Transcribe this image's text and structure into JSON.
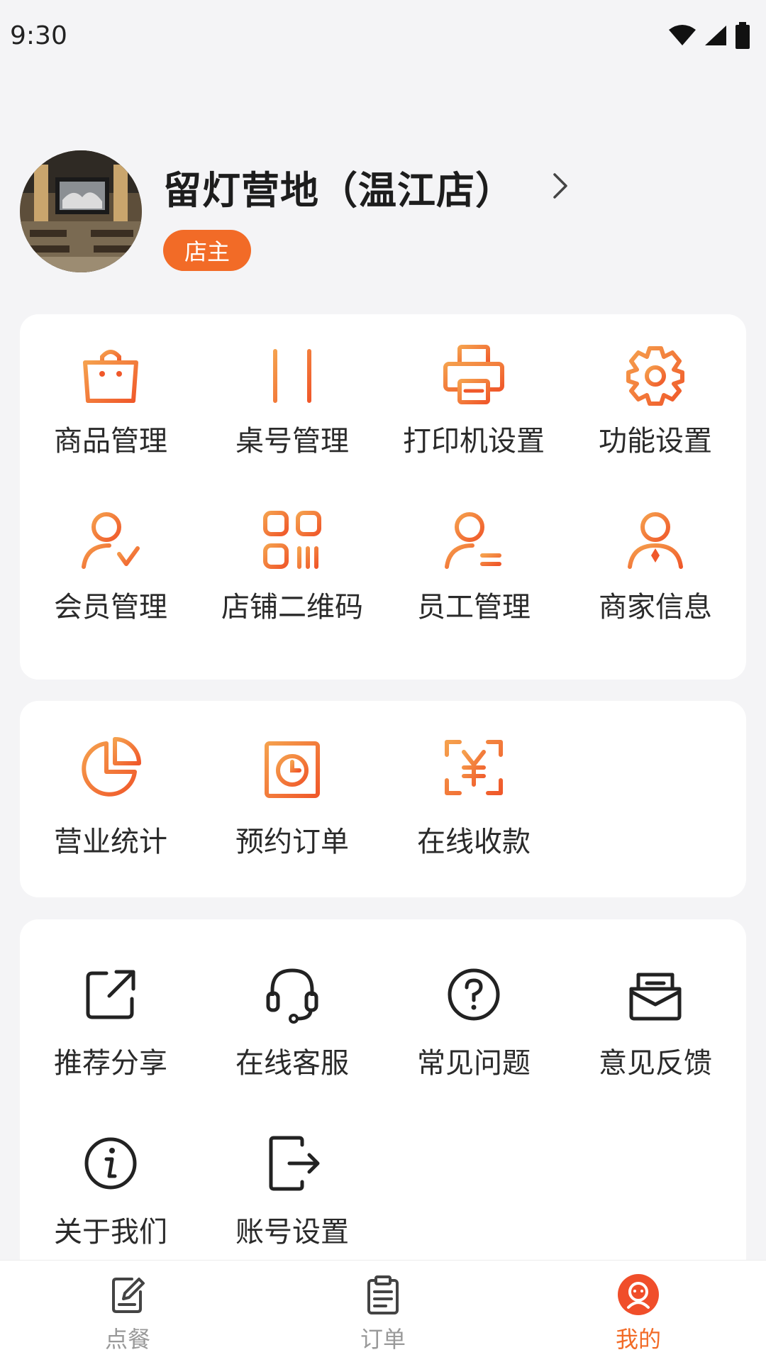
{
  "status_bar": {
    "time": "9:30"
  },
  "profile": {
    "store_name": "留灯营地（温江店）",
    "role_badge": "店主"
  },
  "colors": {
    "accent": "#f26b27",
    "accent_light": "#f5a04d",
    "text": "#222222"
  },
  "card_management": {
    "items": [
      {
        "label": "商品管理",
        "icon": "shopping-bag-icon"
      },
      {
        "label": "桌号管理",
        "icon": "table-icon"
      },
      {
        "label": "打印机设置",
        "icon": "printer-icon"
      },
      {
        "label": "功能设置",
        "icon": "gear-icon"
      },
      {
        "label": "会员管理",
        "icon": "member-check-icon"
      },
      {
        "label": "店铺二维码",
        "icon": "qr-code-icon"
      },
      {
        "label": "员工管理",
        "icon": "staff-icon"
      },
      {
        "label": "商家信息",
        "icon": "merchant-icon"
      }
    ]
  },
  "card_business": {
    "items": [
      {
        "label": "营业统计",
        "icon": "pie-chart-icon"
      },
      {
        "label": "预约订单",
        "icon": "reservation-clock-icon"
      },
      {
        "label": "在线收款",
        "icon": "yuan-scan-icon"
      }
    ]
  },
  "card_support": {
    "items": [
      {
        "label": "推荐分享",
        "icon": "share-icon"
      },
      {
        "label": "在线客服",
        "icon": "headset-icon"
      },
      {
        "label": "常见问题",
        "icon": "question-icon"
      },
      {
        "label": "意见反馈",
        "icon": "feedback-mail-icon"
      },
      {
        "label": "关于我们",
        "icon": "info-icon"
      },
      {
        "label": "账号设置",
        "icon": "logout-icon"
      }
    ]
  },
  "tabbar": {
    "tabs": [
      {
        "label": "点餐",
        "icon": "order-edit-icon",
        "active": false
      },
      {
        "label": "订单",
        "icon": "clipboard-icon",
        "active": false
      },
      {
        "label": "我的",
        "icon": "profile-face-icon",
        "active": true
      }
    ]
  }
}
